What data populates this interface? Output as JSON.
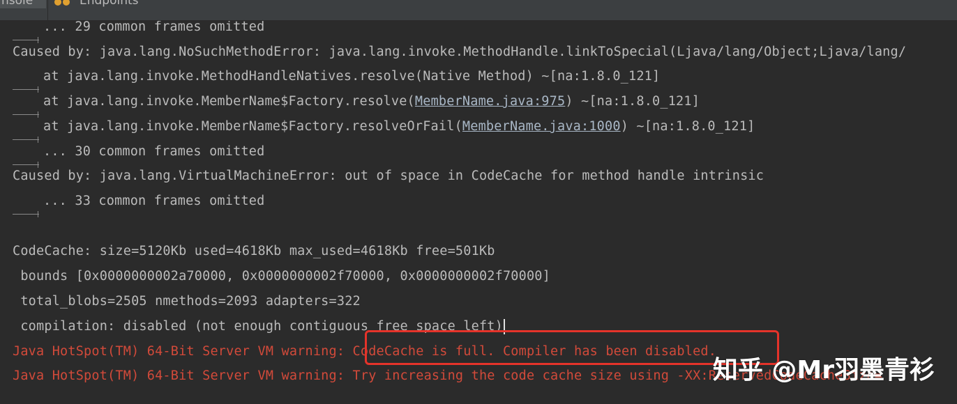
{
  "tabs": {
    "console": "nsole",
    "endpoints": "Endpoints"
  },
  "log": {
    "l1": "... 29 common frames omitted",
    "l2": "Caused by: java.lang.NoSuchMethodError: java.lang.invoke.MethodHandle.linkToSpecial(Ljava/lang/Object;Ljava/lang/",
    "l3": "at java.lang.invoke.MethodHandleNatives.resolve(Native Method) ~[na:1.8.0_121]",
    "l4_pre": "at java.lang.invoke.MemberName$Factory.resolve(",
    "l4_link": "MemberName.java:975",
    "l4_post": ") ~[na:1.8.0_121]",
    "l5_pre": "at java.lang.invoke.MemberName$Factory.resolveOrFail(",
    "l5_link": "MemberName.java:1000",
    "l5_post": ") ~[na:1.8.0_121]",
    "l6": "... 30 common frames omitted",
    "l7": "Caused by: java.lang.VirtualMachineError: out of space in CodeCache for method handle intrinsic",
    "l8": "... 33 common frames omitted",
    "l9": "CodeCache: size=5120Kb used=4618Kb max_used=4618Kb free=501Kb",
    "l10": " bounds [0x0000000002a70000, 0x0000000002f70000, 0x0000000002f70000]",
    "l11": " total_blobs=2505 nmethods=2093 adapters=322",
    "l12": " compilation: disabled (not enough contiguous free space left)",
    "l13": "Java HotSpot(TM) 64-Bit Server VM warning: CodeCache is full. Compiler has been disabled.",
    "l14": "Java HotSpot(TM) 64-Bit Server VM warning: Try increasing the code cache size using -XX:ReservedCodeCacheSize="
  },
  "watermark": "知乎 @Mr羽墨青衫",
  "colors": {
    "background": "#2b2b2b",
    "text": "#bbbbbb",
    "error": "#d24a3a",
    "highlight_box": "#e5332a"
  }
}
